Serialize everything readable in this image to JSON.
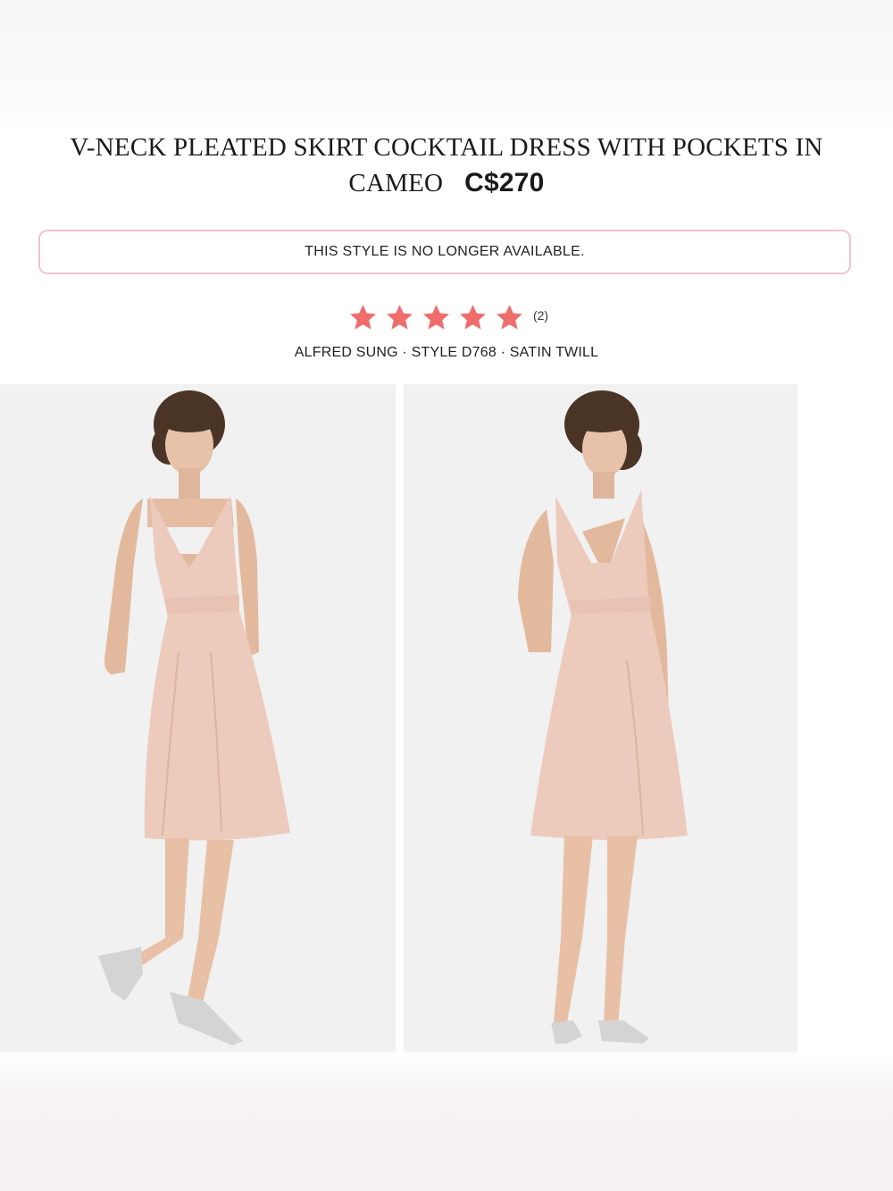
{
  "product": {
    "title": "V-NECK PLEATED SKIRT COCKTAIL DRESS WITH POCKETS IN CAMEO",
    "price": "C$270"
  },
  "availability_notice": "THIS STYLE IS NO LONGER AVAILABLE.",
  "rating": {
    "stars": 5,
    "max_stars": 5,
    "review_count": "(2)",
    "star_color": "#f06d6d"
  },
  "meta_line": "ALFRED SUNG · STYLE D768 · SATIN TWILL",
  "images": [
    {
      "view": "front"
    },
    {
      "view": "back"
    }
  ],
  "colors": {
    "notice_border": "#f4c2cd",
    "dress": "#eccbbd",
    "photo_background": "#f1f1f1"
  }
}
